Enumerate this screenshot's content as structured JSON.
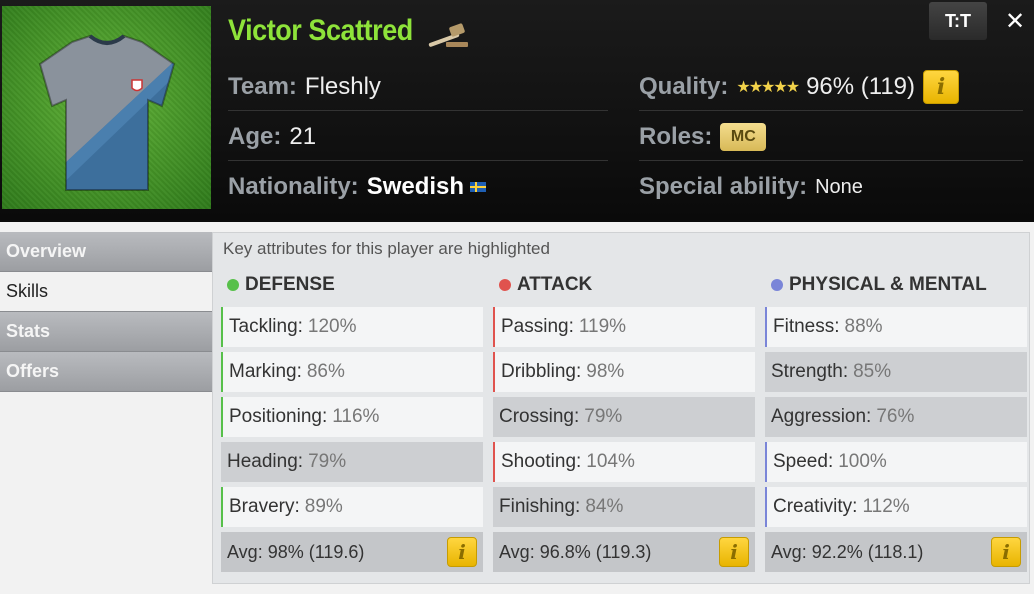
{
  "header": {
    "player_name": "Victor Scattred",
    "team_label": "Team:",
    "team_value": "Fleshly",
    "age_label": "Age:",
    "age_value": "21",
    "nationality_label": "Nationality:",
    "nationality_value": "Swedish",
    "quality_label": "Quality:",
    "quality_stars": "★★★★★",
    "quality_value": "96% (119)",
    "roles_label": "Roles:",
    "role_badge": "MC",
    "special_label": "Special ability:",
    "special_value": "None",
    "info_glyph": "i",
    "compare_label": "T:T",
    "close_label": "✕"
  },
  "sidebar": {
    "tabs": [
      {
        "label": "Overview",
        "active": false
      },
      {
        "label": "Skills",
        "active": true
      },
      {
        "label": "Stats",
        "active": false
      },
      {
        "label": "Offers",
        "active": false
      }
    ]
  },
  "skills": {
    "hint": "Key attributes for this player are highlighted",
    "defense": {
      "title": "DEFENSE",
      "color": "#57c04a",
      "attributes": [
        {
          "name": "Tackling:",
          "value": "120%",
          "key": true
        },
        {
          "name": "Marking:",
          "value": "86%",
          "key": true
        },
        {
          "name": "Positioning:",
          "value": "116%",
          "key": true
        },
        {
          "name": "Heading:",
          "value": "79%",
          "key": false
        },
        {
          "name": "Bravery:",
          "value": "89%",
          "key": true
        }
      ],
      "avg": "Avg: 98% (119.6)"
    },
    "attack": {
      "title": "ATTACK",
      "color": "#e0534e",
      "attributes": [
        {
          "name": "Passing:",
          "value": "119%",
          "key": true
        },
        {
          "name": "Dribbling:",
          "value": "98%",
          "key": true
        },
        {
          "name": "Crossing:",
          "value": "79%",
          "key": false
        },
        {
          "name": "Shooting:",
          "value": "104%",
          "key": true
        },
        {
          "name": "Finishing:",
          "value": "84%",
          "key": false
        }
      ],
      "avg": "Avg: 96.8% (119.3)"
    },
    "physical": {
      "title": "PHYSICAL & MENTAL",
      "color": "#7a85d8",
      "attributes": [
        {
          "name": "Fitness:",
          "value": "88%",
          "key": true
        },
        {
          "name": "Strength:",
          "value": "85%",
          "key": false
        },
        {
          "name": "Aggression:",
          "value": "76%",
          "key": false
        },
        {
          "name": "Speed:",
          "value": "100%",
          "key": true
        },
        {
          "name": "Creativity:",
          "value": "112%",
          "key": true
        }
      ],
      "avg": "Avg: 92.2% (118.1)"
    }
  },
  "icons": {
    "jersey": "jersey-icon",
    "gavel": "gavel-icon",
    "flag": "sweden-flag-icon",
    "info": "info-icon",
    "compare": "compare-shirts-icon",
    "close": "close-icon"
  }
}
